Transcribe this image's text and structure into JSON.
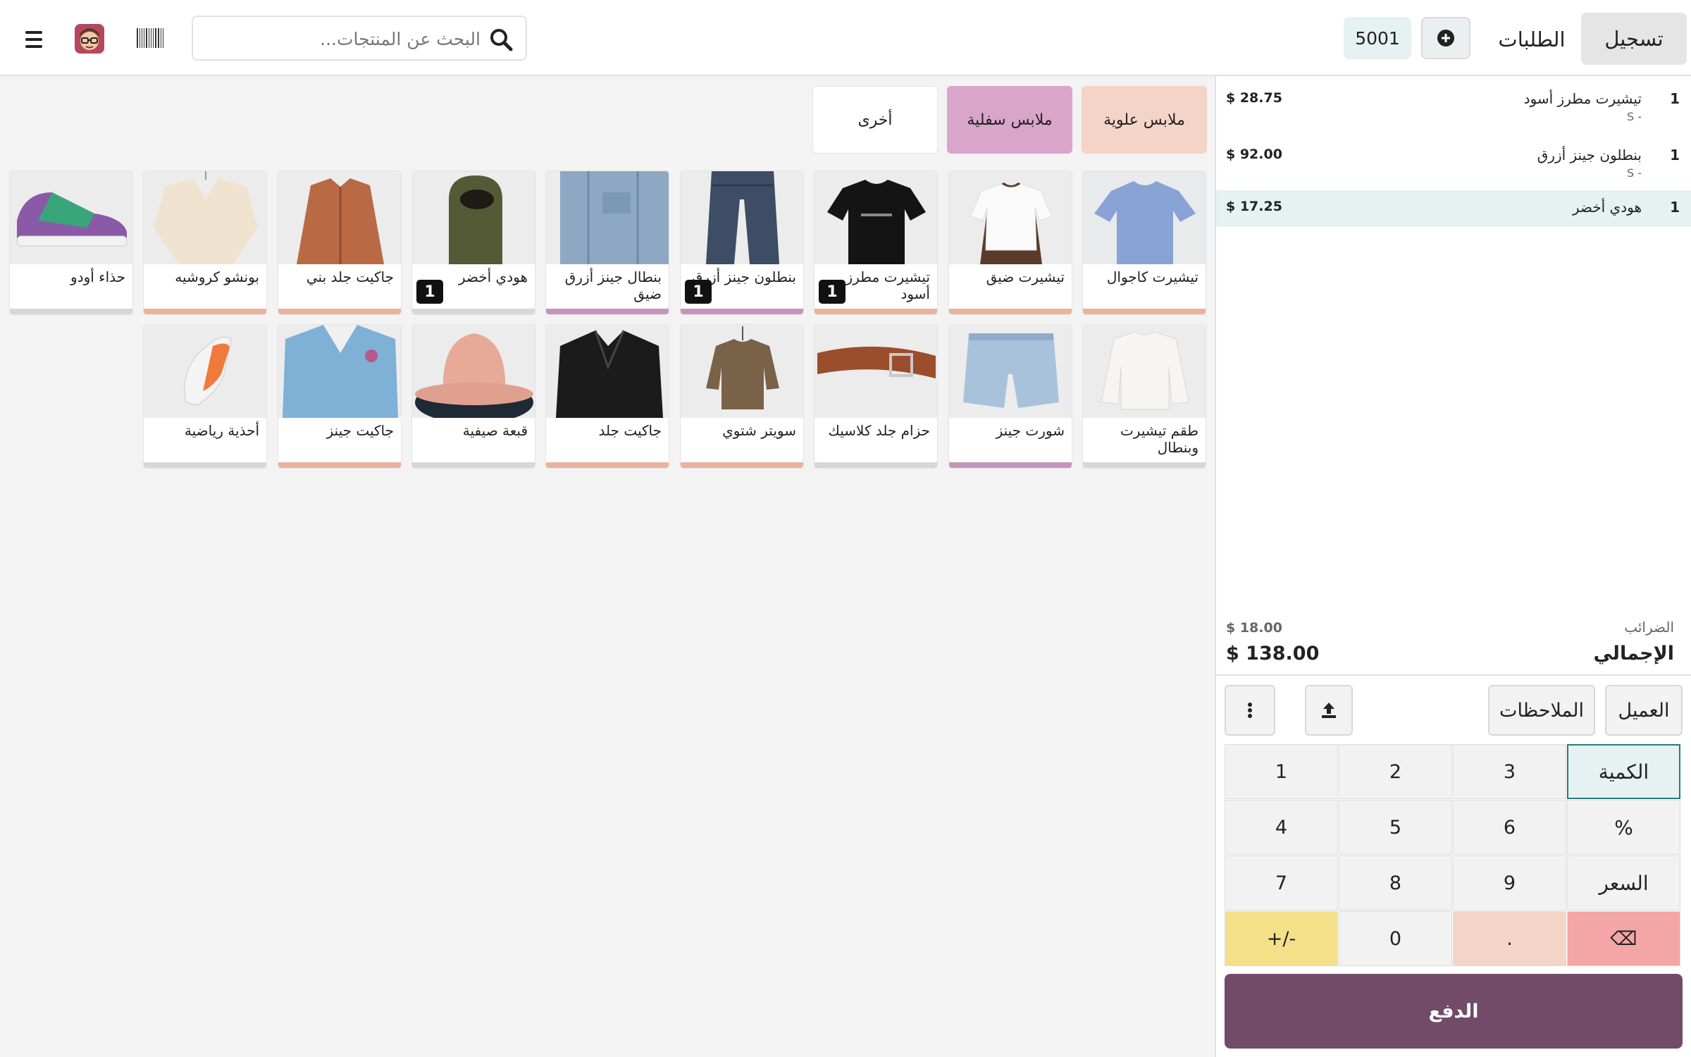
{
  "header": {
    "search_placeholder": "البحث عن المنتجات...",
    "order_number": "5001",
    "tab_orders": "الطلبات",
    "tab_register": "تسجيل"
  },
  "categories": {
    "upper": "ملابس علوية",
    "lower": "ملابس سفلية",
    "other": "أخرى"
  },
  "products": [
    {
      "name": "تيشيرت كاجوال",
      "category": "upper",
      "qty_badge": ""
    },
    {
      "name": "تيشيرت ضيق",
      "category": "upper",
      "qty_badge": ""
    },
    {
      "name": "تيشيرت مطرز أسود",
      "category": "upper",
      "qty_badge": "1"
    },
    {
      "name": "بنطلون جينز أزرق",
      "category": "lower",
      "qty_badge": "1"
    },
    {
      "name": "بنطال جينز أزرق ضيق",
      "category": "lower",
      "qty_badge": ""
    },
    {
      "name": "هودي أخضر",
      "category": "other",
      "qty_badge": "1"
    },
    {
      "name": "جاكيت جلد بني",
      "category": "upper",
      "qty_badge": ""
    },
    {
      "name": "بونشو كروشيه",
      "category": "upper",
      "qty_badge": ""
    },
    {
      "name": "حذاء أودو",
      "category": "other",
      "qty_badge": ""
    },
    {
      "name": "طقم تيشيرت وبنطال",
      "category": "other",
      "qty_badge": ""
    },
    {
      "name": "شورت جينز",
      "category": "lower",
      "qty_badge": ""
    },
    {
      "name": "حزام جلد كلاسيك",
      "category": "other",
      "qty_badge": ""
    },
    {
      "name": "سويتر شتوي",
      "category": "upper",
      "qty_badge": ""
    },
    {
      "name": "جاكيت جلد",
      "category": "upper",
      "qty_badge": ""
    },
    {
      "name": "قبعة صيفية",
      "category": "other",
      "qty_badge": ""
    },
    {
      "name": "جاكيت جينز",
      "category": "upper",
      "qty_badge": ""
    },
    {
      "name": "أحذية رياضية",
      "category": "other",
      "qty_badge": ""
    }
  ],
  "order": {
    "lines": [
      {
        "qty": "1",
        "name": "تيشيرت مطرز أسود",
        "sub": "- S",
        "price": "$ 28.75"
      },
      {
        "qty": "1",
        "name": "بنطلون جينز أزرق",
        "sub": "- S",
        "price": "$ 92.00"
      },
      {
        "qty": "1",
        "name": "هودي أخضر",
        "sub": "",
        "price": "$ 17.25"
      }
    ],
    "taxes_label": "الضرائب",
    "taxes_value": "$ 18.00",
    "total_label": "الإجمالي",
    "total_value": "$ 138.00"
  },
  "actions": {
    "customer": "العميل",
    "notes": "الملاحظات"
  },
  "numpad": {
    "keys": [
      "1",
      "2",
      "3",
      "الكمية",
      "4",
      "5",
      "6",
      "%",
      "7",
      "8",
      "9",
      "السعر",
      "+/-",
      "0",
      ".",
      "⌫"
    ]
  },
  "pay_label": "الدفع",
  "colors": {
    "brand": "#714b67",
    "upper": "#ebb39e",
    "lower": "#c596bc",
    "selected_line": "#e6f1f1"
  }
}
